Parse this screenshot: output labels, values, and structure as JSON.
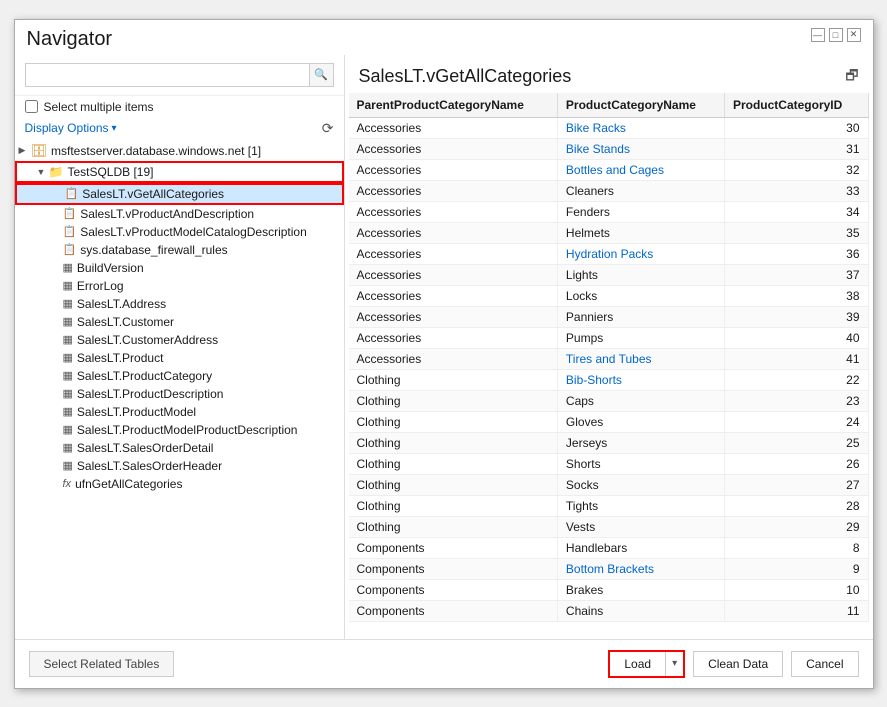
{
  "dialog": {
    "title": "Navigator"
  },
  "title_bar": {
    "minimize_label": "—",
    "maximize_label": "□",
    "close_label": "✕"
  },
  "left_panel": {
    "search_placeholder": "",
    "select_multiple_label": "Select multiple items",
    "display_options_label": "Display Options",
    "display_options_arrow": "▾",
    "refresh_icon": "⟳",
    "tree": [
      {
        "level": 0,
        "type": "server",
        "label": "msftestserver.database.windows.net [1]",
        "expanded": true,
        "arrow": "▶"
      },
      {
        "level": 1,
        "type": "db",
        "label": "TestSQLDB [19]",
        "expanded": true,
        "arrow": "▼",
        "outlined": true
      },
      {
        "level": 2,
        "type": "view",
        "label": "SalesLT.vGetAllCategories",
        "selected": true
      },
      {
        "level": 2,
        "type": "view",
        "label": "SalesLT.vProductAndDescription"
      },
      {
        "level": 2,
        "type": "view",
        "label": "SalesLT.vProductModelCatalogDescription"
      },
      {
        "level": 2,
        "type": "view",
        "label": "sys.database_firewall_rules"
      },
      {
        "level": 2,
        "type": "table",
        "label": "BuildVersion"
      },
      {
        "level": 2,
        "type": "table",
        "label": "ErrorLog"
      },
      {
        "level": 2,
        "type": "table",
        "label": "SalesLT.Address"
      },
      {
        "level": 2,
        "type": "table",
        "label": "SalesLT.Customer"
      },
      {
        "level": 2,
        "type": "table",
        "label": "SalesLT.CustomerAddress"
      },
      {
        "level": 2,
        "type": "table",
        "label": "SalesLT.Product"
      },
      {
        "level": 2,
        "type": "table",
        "label": "SalesLT.ProductCategory"
      },
      {
        "level": 2,
        "type": "table",
        "label": "SalesLT.ProductDescription"
      },
      {
        "level": 2,
        "type": "table",
        "label": "SalesLT.ProductModel"
      },
      {
        "level": 2,
        "type": "table",
        "label": "SalesLT.ProductModelProductDescription"
      },
      {
        "level": 2,
        "type": "table",
        "label": "SalesLT.SalesOrderDetail"
      },
      {
        "level": 2,
        "type": "table",
        "label": "SalesLT.SalesOrderHeader"
      },
      {
        "level": 2,
        "type": "func",
        "label": "ufnGetAllCategories"
      }
    ]
  },
  "right_panel": {
    "preview_title": "SalesLT.vGetAllCategories",
    "columns": [
      "ParentProductCategoryName",
      "ProductCategoryName",
      "ProductCategoryID"
    ],
    "rows": [
      [
        "Accessories",
        "Bike Racks",
        "30"
      ],
      [
        "Accessories",
        "Bike Stands",
        "31"
      ],
      [
        "Accessories",
        "Bottles and Cages",
        "32"
      ],
      [
        "Accessories",
        "Cleaners",
        "33"
      ],
      [
        "Accessories",
        "Fenders",
        "34"
      ],
      [
        "Accessories",
        "Helmets",
        "35"
      ],
      [
        "Accessories",
        "Hydration Packs",
        "36"
      ],
      [
        "Accessories",
        "Lights",
        "37"
      ],
      [
        "Accessories",
        "Locks",
        "38"
      ],
      [
        "Accessories",
        "Panniers",
        "39"
      ],
      [
        "Accessories",
        "Pumps",
        "40"
      ],
      [
        "Accessories",
        "Tires and Tubes",
        "41"
      ],
      [
        "Clothing",
        "Bib-Shorts",
        "22"
      ],
      [
        "Clothing",
        "Caps",
        "23"
      ],
      [
        "Clothing",
        "Gloves",
        "24"
      ],
      [
        "Clothing",
        "Jerseys",
        "25"
      ],
      [
        "Clothing",
        "Shorts",
        "26"
      ],
      [
        "Clothing",
        "Socks",
        "27"
      ],
      [
        "Clothing",
        "Tights",
        "28"
      ],
      [
        "Clothing",
        "Vests",
        "29"
      ],
      [
        "Components",
        "Handlebars",
        "8"
      ],
      [
        "Components",
        "Bottom Brackets",
        "9"
      ],
      [
        "Components",
        "Brakes",
        "10"
      ],
      [
        "Components",
        "Chains",
        "11"
      ]
    ]
  },
  "bottom_bar": {
    "select_related_label": "Select Related Tables",
    "load_label": "Load",
    "load_dropdown_icon": "▾",
    "clean_data_label": "Clean Data",
    "cancel_label": "Cancel"
  }
}
